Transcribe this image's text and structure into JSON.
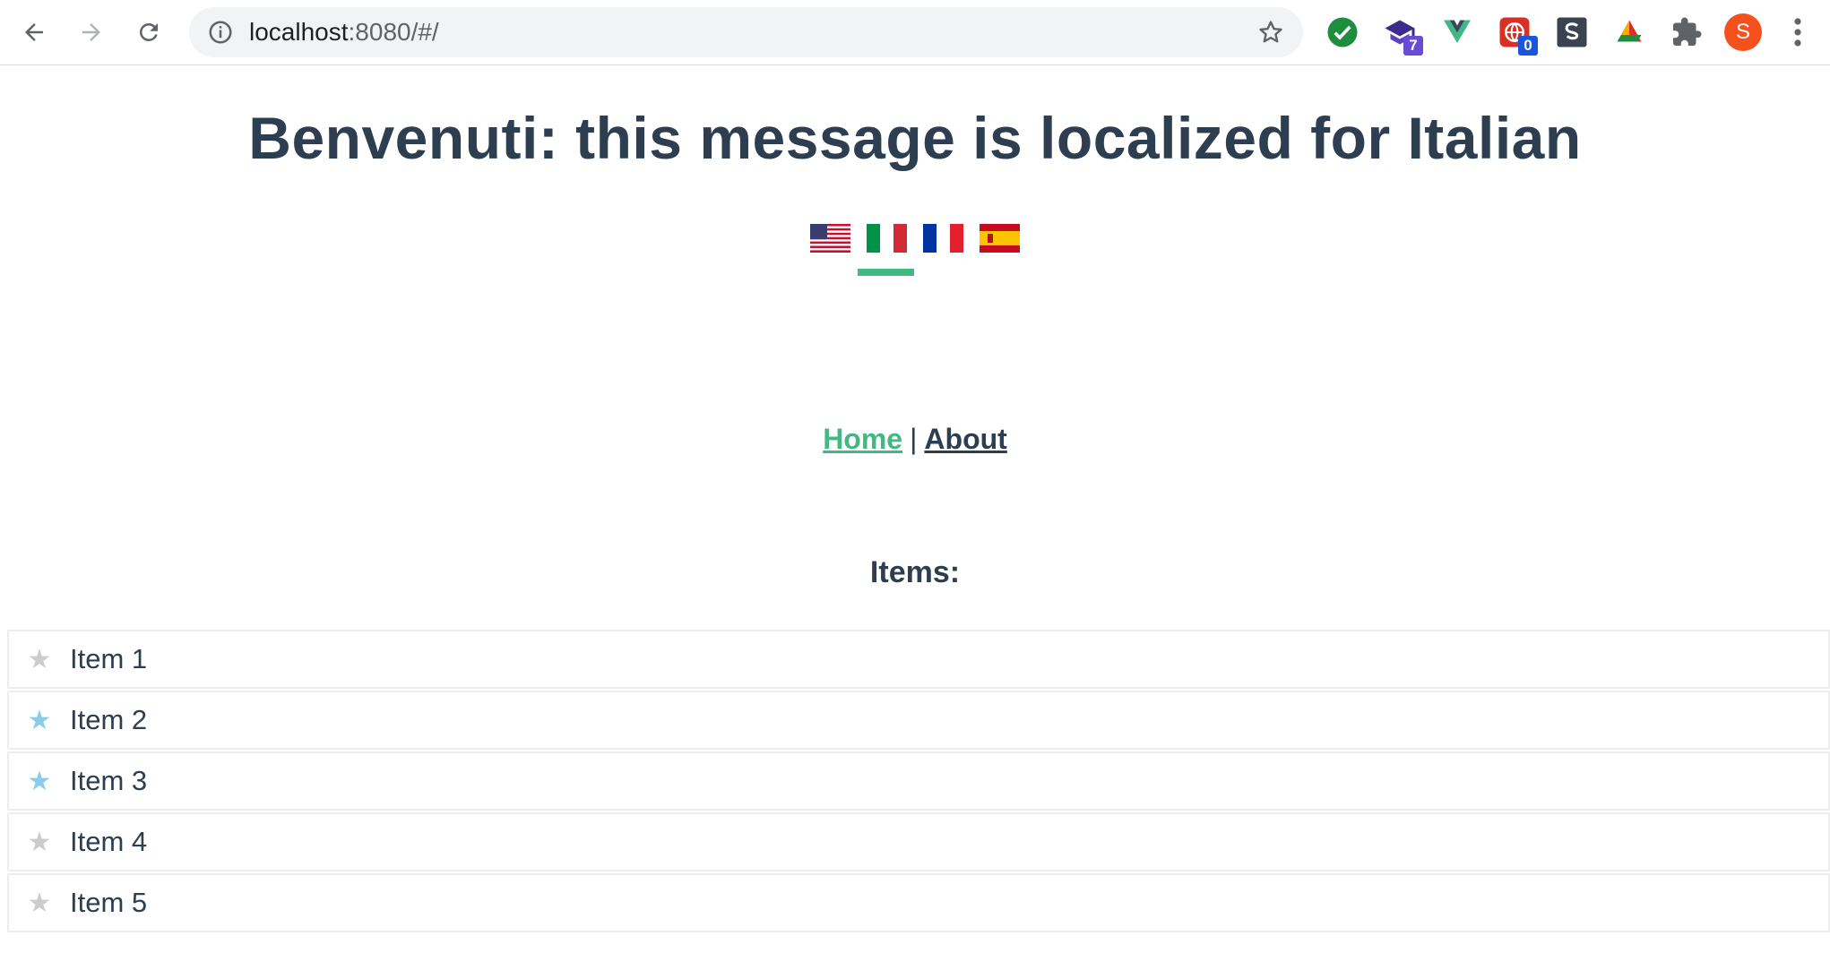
{
  "browser": {
    "url_host": "localhost",
    "url_path": ":8080/#/",
    "extensions": [
      {
        "name": "check-extension",
        "badge": ""
      },
      {
        "name": "graduation-extension",
        "badge": "7"
      },
      {
        "name": "vue-devtools-extension",
        "badge": ""
      },
      {
        "name": "red-globe-extension",
        "badge": "0"
      },
      {
        "name": "s-extension",
        "badge": ""
      },
      {
        "name": "triangle-extension",
        "badge": ""
      }
    ],
    "profile_initial": "S"
  },
  "page": {
    "headline": "Benvenuti: this message is localized for Italian",
    "languages": [
      {
        "code": "en",
        "active": false
      },
      {
        "code": "it",
        "active": true
      },
      {
        "code": "fr",
        "active": false
      },
      {
        "code": "es",
        "active": false
      }
    ],
    "nav": {
      "home": "Home",
      "separator": "|",
      "about": "About"
    },
    "items_heading": "Items:",
    "items": [
      {
        "label": "Item 1",
        "favorite": false
      },
      {
        "label": "Item 2",
        "favorite": true
      },
      {
        "label": "Item 3",
        "favorite": true
      },
      {
        "label": "Item 4",
        "favorite": false
      },
      {
        "label": "Item 5",
        "favorite": false
      }
    ]
  }
}
